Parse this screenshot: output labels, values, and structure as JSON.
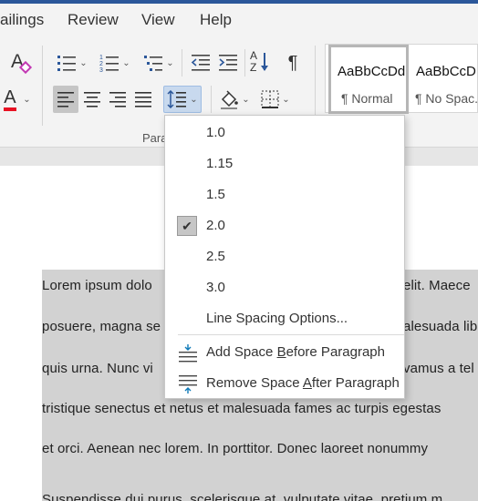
{
  "menubar": {
    "items": [
      "ailings",
      "Review",
      "View",
      "Help"
    ]
  },
  "ribbon": {
    "group_label": "Para",
    "format_painter_glyph": "A",
    "font_color_glyph": "A",
    "font_color": "#e81123",
    "sort_glyph": "A",
    "sort_glyph_2": "Z",
    "pilcrow_glyph": "¶",
    "styles": [
      {
        "sample": "AaBbCcDd",
        "name": "¶ Normal",
        "selected": true
      },
      {
        "sample": "AaBbCcD",
        "name": "¶ No Spac..."
      }
    ]
  },
  "line_spacing_menu": {
    "options": [
      "1.0",
      "1.15",
      "1.5",
      "2.0",
      "2.5",
      "3.0"
    ],
    "checked": "2.0",
    "check_glyph": "✔",
    "options_label": "Line Spacing Options...",
    "add_space": {
      "pre": "Add Space ",
      "key": "B",
      "post": "efore Paragraph"
    },
    "remove_space": {
      "pre": "Remove Space ",
      "key": "A",
      "post": "fter Paragraph"
    }
  },
  "document": {
    "lines": [
      {
        "left": "Lorem ipsum dolo",
        "right": "elit. Maece"
      },
      {
        "left": "posuere, magna se",
        "right": "alesuada lib"
      },
      {
        "left": "quis urna. Nunc vi",
        "right": "vamus a tel"
      },
      {
        "left": "tristique senectus et netus et malesuada fames ac turpis egestas"
      },
      {
        "left": "et orci. Aenean nec lorem. In porttitor. Donec laoreet nonummy"
      },
      {
        "left": "Suspendisse dui purus, scelerisque at, vulputate vitae, pretium m"
      }
    ]
  },
  "colors": {
    "accent_bar": "#2b579a",
    "selection": "#d2d2d2",
    "icon_blue": "#2b579a",
    "icon_teal": "#0f7ab8"
  }
}
